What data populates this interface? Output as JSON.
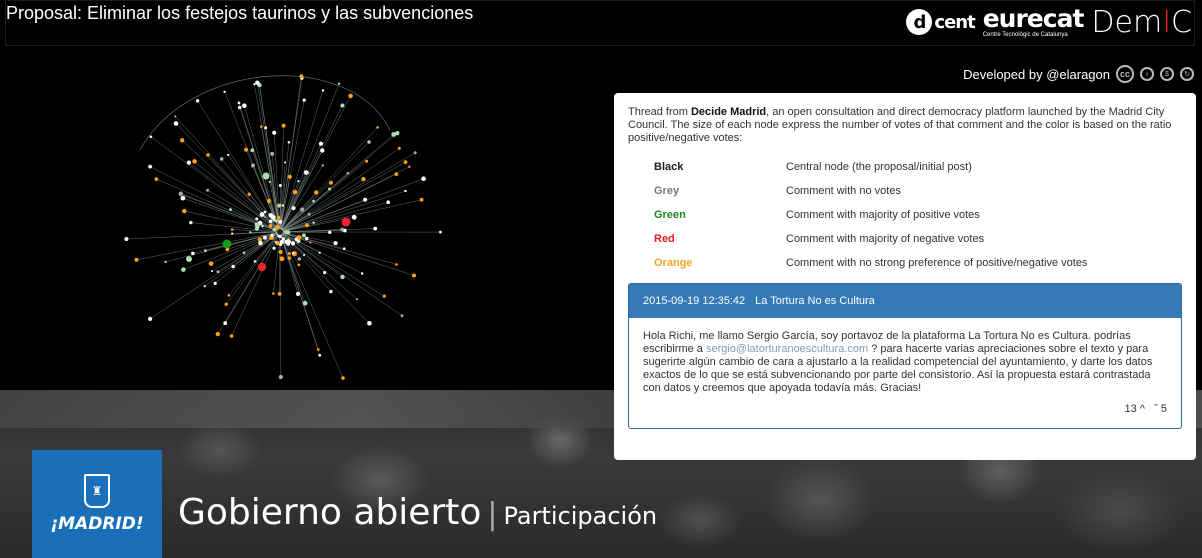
{
  "header": {
    "title": "Proposal: Eliminar los festejos taurinos y las subvenciones",
    "logos": {
      "dcent_letter": "d",
      "dcent_text": "cent",
      "eurecat": "eurecat",
      "eurecat_tagline": "Centre Tecnològic de Catalunya",
      "demic_a": "Dem",
      "demic_b": "I",
      "demic_c": "C"
    }
  },
  "credit": {
    "text": "Developed by @elaragon",
    "icons": [
      "creative-commons-icon",
      "attribution-icon",
      "noncommercial-icon",
      "share-alike-icon"
    ]
  },
  "graph": {
    "node_colors": {
      "black": "#222222",
      "grey": "#aaaaaa",
      "green": "#a8e0a8",
      "dark_green": "#1a9a1a",
      "red": "#e8252a",
      "orange": "#ff9f1a",
      "white": "#ffffff"
    }
  },
  "panel": {
    "intro_prefix": "Thread from ",
    "intro_bold": "Decide Madrid",
    "intro_suffix": ", an open consultation and direct democracy platform launched by the Madrid City Council. The size of each node express the number of votes of that comment and the color is based on the ratio positive/negative votes:",
    "legend": [
      {
        "name": "Black",
        "color": "#222222",
        "desc": "Central node (the proposal/initial post)"
      },
      {
        "name": "Grey",
        "color": "#777777",
        "desc": "Comment with no votes"
      },
      {
        "name": "Green",
        "color": "#1a8a1a",
        "desc": "Comment with majority of positive votes"
      },
      {
        "name": "Red",
        "color": "#e8191e",
        "desc": "Comment with majority of negative votes"
      },
      {
        "name": "Orange",
        "color": "#f5a623",
        "desc": "Comment with no strong preference of positive/negative votes"
      }
    ],
    "comment": {
      "timestamp": "2015-09-19 12:35:42",
      "author": "La Tortura No es Cultura",
      "body_a": "Hola Richi, me llamo Sergio García, soy portavoz de la plataforma La Tortura No es Cultura. podrías escribirme a ",
      "email": "sergio@latorturanoescultura.com",
      "body_b": " ? para hacerte varias apreciaciones sobre el texto y para sugerirte algún cambio de cara a ajustarlo a la realidad competencial del ayuntamiento, y darte los datos exactos de lo que se está subvencionando por parte del consistorio. Así la propuesta estará contrastada con datos y creemos que apoyada todavía más. Gracias!",
      "upvotes": "13",
      "downvotes": "5"
    }
  },
  "footer": {
    "madrid_logo": "¡MADRID!",
    "title_main": "Gobierno abierto",
    "separator": "|",
    "title_sub": "Participación"
  }
}
